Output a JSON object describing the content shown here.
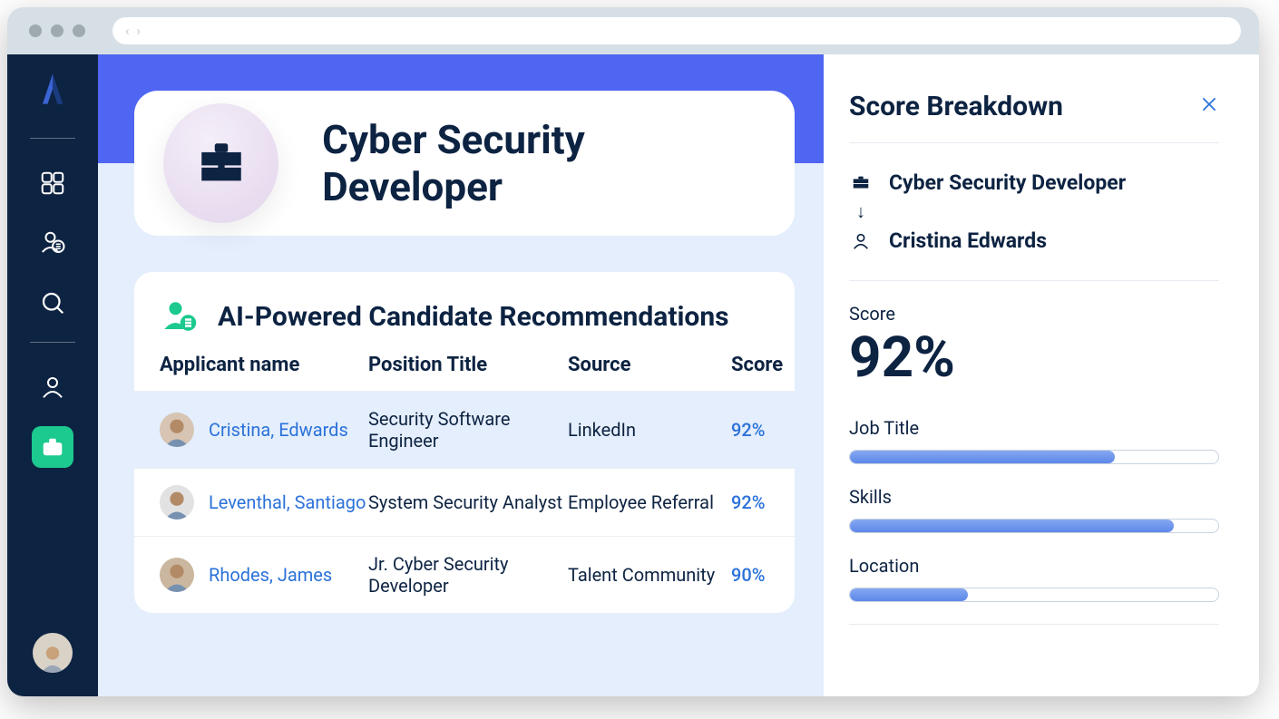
{
  "sidebar": {
    "items": [
      "grid",
      "person-list",
      "search",
      "divider",
      "user",
      "briefcase"
    ],
    "active_index": 5
  },
  "job": {
    "title": "Cyber Security Developer"
  },
  "recommendations": {
    "title": "AI-Powered Candidate Recommendations",
    "columns": {
      "name": "Applicant name",
      "position": "Position Title",
      "source": "Source",
      "score": "Score"
    },
    "rows": [
      {
        "name": "Cristina, Edwards",
        "position": "Security Software Engineer",
        "source": "LinkedIn",
        "score": "92%",
        "selected": true,
        "avatar_bg": "#d7c4b2"
      },
      {
        "name": "Leventhal, Santiago",
        "position": "System Security Analyst",
        "source": "Employee Referral",
        "score": "92%",
        "selected": false,
        "avatar_bg": "#e2e2e2"
      },
      {
        "name": "Rhodes, James",
        "position": "Jr. Cyber Security Developer",
        "source": "Talent Community",
        "score": "90%",
        "selected": false,
        "avatar_bg": "#cbb79f"
      }
    ]
  },
  "breakdown": {
    "title": "Score Breakdown",
    "job_title": "Cyber Security Developer",
    "candidate": "Cristina Edwards",
    "score_label": "Score",
    "score_value": "92%",
    "metrics": [
      {
        "label": "Job Title",
        "pct": 72
      },
      {
        "label": "Skills",
        "pct": 88
      },
      {
        "label": "Location",
        "pct": 32
      }
    ]
  }
}
